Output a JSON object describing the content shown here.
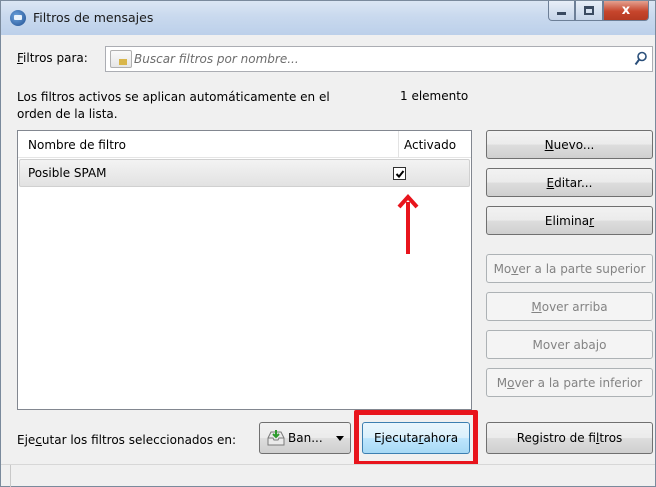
{
  "window": {
    "title": "Filtros de mensajes",
    "controls": {
      "minimize": "minimize",
      "maximize": "maximize",
      "close": "x"
    }
  },
  "search": {
    "label_prefix": "",
    "label_access": "F",
    "label_rest": "iltros para:",
    "placeholder": "Buscar filtros por nombre..."
  },
  "info": {
    "text": "Los filtros activos se aplican automáticamente en el orden de la lista.",
    "count": "1 elemento"
  },
  "list": {
    "columns": {
      "name": "Nombre de filtro",
      "enabled": "Activado"
    },
    "rows": [
      {
        "name": "Posible SPAM",
        "enabled": true
      }
    ]
  },
  "buttons": {
    "new": {
      "pre": "",
      "key": "N",
      "post": "uevo...",
      "disabled": false
    },
    "edit": {
      "pre": "",
      "key": "E",
      "post": "ditar...",
      "disabled": false
    },
    "delete": {
      "pre": "Elimina",
      "key": "r",
      "post": "",
      "disabled": false
    },
    "move_top": {
      "pre": "Mo",
      "key": "v",
      "post": "er a la parte superior",
      "disabled": true
    },
    "move_up": {
      "pre": "",
      "key": "M",
      "post": "over arriba",
      "disabled": true
    },
    "move_down": {
      "pre": "Mover aba",
      "key": "j",
      "post": "o",
      "disabled": true
    },
    "move_bottom": {
      "pre": "M",
      "key": "o",
      "post": "ver a la parte inferior",
      "disabled": true
    }
  },
  "bottom": {
    "run_label_pre": "Eje",
    "run_label_key": "c",
    "run_label_post": "utar los filtros seleccionados en:",
    "folder": "Ban...",
    "run_now": {
      "pre": "Ejecuta",
      "key": "r",
      "post": " ahora"
    },
    "log": {
      "pre": "Registro de fi",
      "key": "l",
      "post": "tros"
    }
  },
  "colors": {
    "highlight": "#e8141c",
    "arrow": "#e8141c",
    "run_button": "#bee6fd"
  }
}
